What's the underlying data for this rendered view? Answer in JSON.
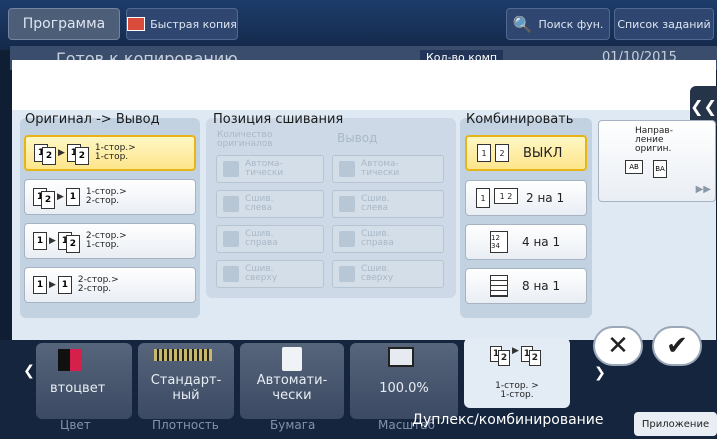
{
  "topbar": {
    "program_label": "Программа",
    "quick_copy_label": "Быстрая копия",
    "search_label": "Поиск фун.",
    "jobs_label": "Список заданий"
  },
  "status": {
    "title": "Готов к копированию",
    "count_label": "Кол-во комп",
    "date": "01/10/2015"
  },
  "dialog": {
    "original_output": {
      "title": "Оригинал -> Вывод",
      "options": [
        {
          "label": "1-стор.>\n1-стор.",
          "selected": true
        },
        {
          "label": "1-стор.>\n2-стор.",
          "selected": false
        },
        {
          "label": "2-стор.>\n1-стор.",
          "selected": false
        },
        {
          "label": "2-стор.>\n2-стор.",
          "selected": false
        }
      ]
    },
    "binding": {
      "title": "Позиция сшивания",
      "col_originals": "Количество\nоригиналов",
      "col_output": "Вывод",
      "originals_options": [
        "Автома-\nтически",
        "Сшив.\nслева",
        "Сшив.\nсправа",
        "Сшив.\nсверху"
      ],
      "output_options": [
        "Автома-\nтически",
        "Сшив.\nслева",
        "Сшив.\nсправа",
        "Сшив.\nсверху"
      ]
    },
    "combine": {
      "title": "Комбинировать",
      "options": [
        {
          "label": "ВЫКЛ",
          "selected": true
        },
        {
          "label": "2 на 1",
          "selected": false
        },
        {
          "label": "4 на 1",
          "selected": false
        },
        {
          "label": "8 на 1",
          "selected": false
        }
      ]
    },
    "orientation": {
      "label": "Направ-\nление\nоригин."
    }
  },
  "bottom": {
    "tiles": [
      {
        "value": "втоцвет",
        "tab": "Цвет"
      },
      {
        "value": "Стандарт-\nный",
        "tab": "Плотность"
      },
      {
        "value": "Автомати-\nчески",
        "tab": "Бумага"
      },
      {
        "value": "100.0%",
        "tab": "Масштаб"
      }
    ],
    "active_tile_value": "1-стор. >\n1-стор.",
    "active_tab": "Дуплекс/комбинирование",
    "apps_label": "Приложение"
  }
}
